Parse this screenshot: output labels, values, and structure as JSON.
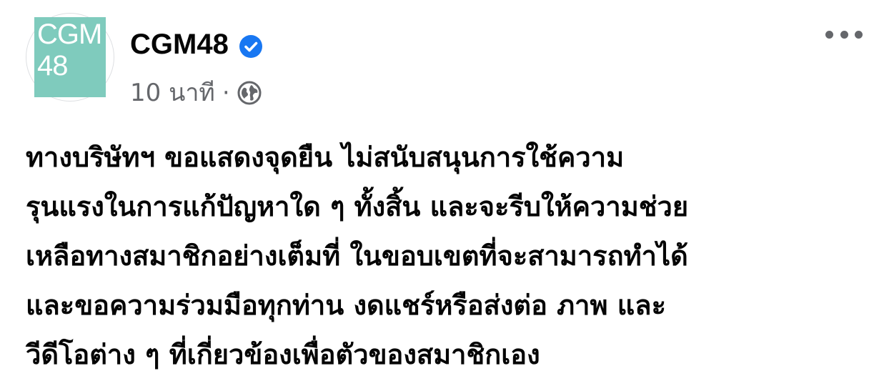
{
  "post": {
    "avatar_text": "CGM\n48",
    "page_name": "CGM48",
    "time": "10 นาที",
    "separator": "·",
    "lines": [
      "ทางบริษัทฯ ขอแสดงจุดยืน ไม่สนับสนุนการใช้ความ",
      "รุนแรงในการแก้ปัญหาใด ๆ ทั้งสิ้น และจะรีบให้ความช่วย",
      "เหลือทางสมาชิกอย่างเต็มที่ ในขอบเขตที่จะสามารถทำได้",
      "และขอความร่วมมือทุกท่าน งดแชร์หรือส่งต่อ ภาพ และ",
      "วีดีโอต่าง ๆ ที่เกี่ยวข้องเพื่อตัวของสมาชิกเอง"
    ]
  },
  "colors": {
    "avatar_bg": "#7fcbbd",
    "verified_blue": "#1877f2",
    "meta_gray": "#65676b"
  },
  "icons": {
    "verified": "verified-badge-icon",
    "audience": "globe-icon",
    "more": "more-options-icon"
  }
}
